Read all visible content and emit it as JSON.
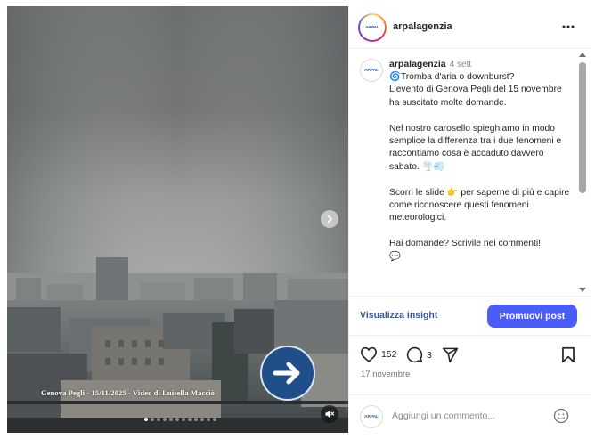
{
  "media": {
    "overlay_caption": "Genova Pegli - 15/11/2025 - Video di Luisella Macciò",
    "slide_count": 12,
    "active_slide": 0,
    "icons": {
      "next": "chevron-right-icon",
      "badge": "arrow-right-icon",
      "mute": "speaker-muted-icon"
    }
  },
  "header": {
    "username": "arpalagenzia",
    "avatar_logo": "ARPAL",
    "more_icon": "more-horizontal-icon"
  },
  "post": {
    "username": "arpalagenzia",
    "time": "4 sett",
    "body": "🌀Tromba d'aria o downburst?\nL'evento di Genova Pegli del 15 novembre ha suscitato molte domande.\n\nNel nostro carosello spieghiamo in modo semplice la differenza tra i due fenomeni e raccontiamo cosa è accaduto davvero sabato. 🌪️💨\n\nScorri le slide 👉 per saperne di più e capire come riconoscere questi fenomeni meteorologici.\n\nHai domande? Scrivile nei commenti!\n💬"
  },
  "insights": {
    "link_label": "Visualizza insight",
    "promote_label": "Promuovi post"
  },
  "actions": {
    "likes": "152",
    "comments": "3",
    "date": "17 novembre",
    "icons": {
      "like": "heart-icon",
      "comment": "comment-icon",
      "share": "share-icon",
      "save": "bookmark-icon"
    }
  },
  "add_comment": {
    "placeholder": "Aggiungi un commento...",
    "emoji_icon": "smiley-icon"
  },
  "colors": {
    "primary_button": "#4a5df9",
    "insight_link": "#385898",
    "badge_blue": "#1f4e89"
  }
}
